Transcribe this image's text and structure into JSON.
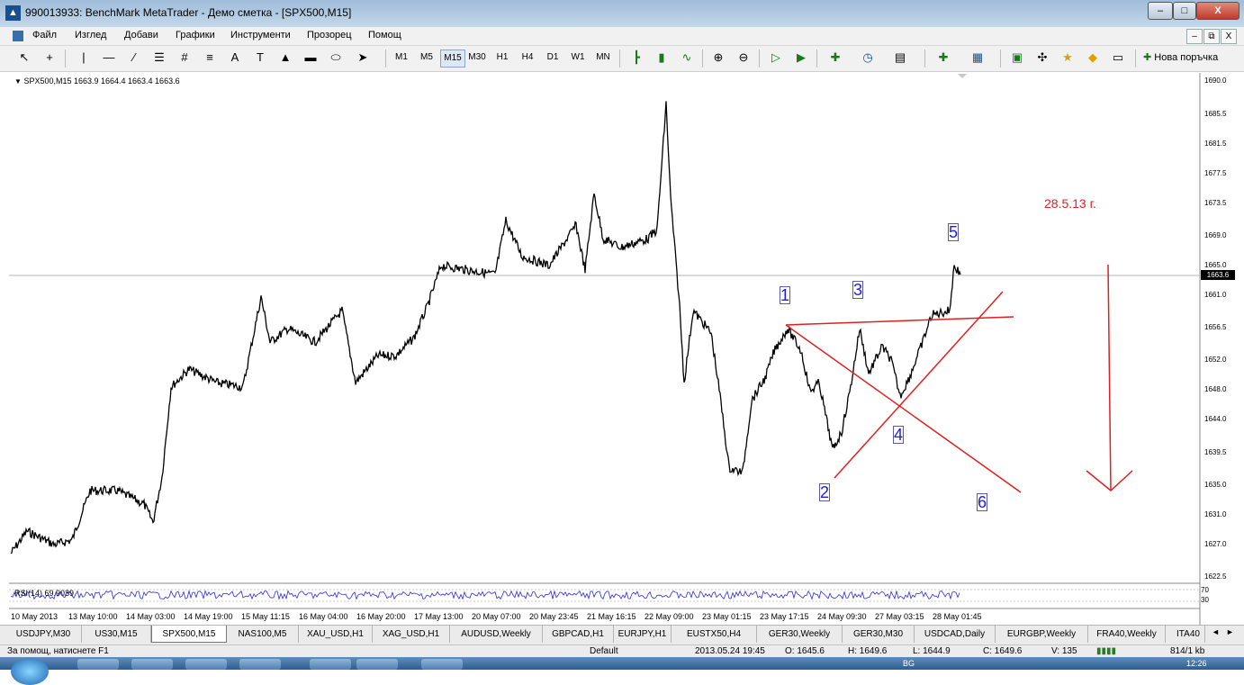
{
  "window": {
    "title": "990013933: BenchMark MetaTrader - Демо сметка - [SPX500,M15]",
    "minimize_label": "–",
    "maximize_label": "□",
    "close_label": "X"
  },
  "menu": {
    "items": [
      "Файл",
      "Изглед",
      "Добави",
      "Графики",
      "Инструменти",
      "Прозорец",
      "Помощ"
    ],
    "mdi_minimize": "–",
    "mdi_restore": "⧉",
    "mdi_close": "X"
  },
  "toolbar": {
    "timeframes": [
      "M1",
      "M5",
      "M15",
      "M30",
      "H1",
      "H4",
      "D1",
      "W1",
      "MN"
    ],
    "active_timeframe": "M15",
    "new_order_label": "Нова поръчка"
  },
  "chart": {
    "symbol_label": "SPX500,M15  1663.9 1664.4 1663.4 1663.6",
    "current_price": "1663.6",
    "price_labels": [
      "1690.0",
      "1685.5",
      "1681.5",
      "1677.5",
      "1673.5",
      "1669.0",
      "1665.0",
      "1661.0",
      "1656.5",
      "1652.0",
      "1648.0",
      "1644.0",
      "1639.5",
      "1635.0",
      "1631.0",
      "1627.0",
      "1622.5"
    ],
    "time_labels": [
      "10 May 2013",
      "13 May 10:00",
      "14 May 03:00",
      "14 May 19:00",
      "15 May 11:15",
      "16 May 04:00",
      "16 May 20:00",
      "17 May 13:00",
      "20 May 07:00",
      "20 May 23:45",
      "21 May 16:15",
      "22 May 09:00",
      "23 May 01:15",
      "23 May 17:15",
      "24 May 09:30",
      "27 May 03:15",
      "28 May 01:45"
    ],
    "date_note": "28.5.13 г.",
    "wave_labels": [
      "1",
      "2",
      "3",
      "4",
      "5",
      "6"
    ],
    "line_color": "#000000",
    "annotation_color": "#e02020",
    "wave_color": "#1e1ee8"
  },
  "rsi": {
    "label": "RSI(14) 69.9039",
    "level_high": "70",
    "level_low": "30",
    "line_color": "#2c2ce0"
  },
  "tabs": {
    "items": [
      "USDJPY,M30",
      "US30,M15",
      "SPX500,M15",
      "NAS100,M5",
      "XAU_USD,H1",
      "XAG_USD,H1",
      "AUDUSD,Weekly",
      "GBPCAD,H1",
      "EURJPY,H1",
      "EUSTX50,H4",
      "GER30,Weekly",
      "GER30,M30",
      "USDCAD,Daily",
      "EURGBP,Weekly",
      "FRA40,Weekly",
      "ITA40"
    ],
    "active": "SPX500,M15",
    "nav_left": "◄",
    "nav_right": "►"
  },
  "status": {
    "help": "За помощ, натиснете F1",
    "profile": "Default",
    "datetime": "2013.05.24 19:45",
    "open": "O: 1645.6",
    "high": "H: 1649.6",
    "low": "L: 1644.9",
    "close": "C: 1649.6",
    "volume": "V: 135",
    "traffic": "814/1 kb"
  },
  "taskbar": {
    "lang": "BG",
    "clock": "12:26"
  }
}
